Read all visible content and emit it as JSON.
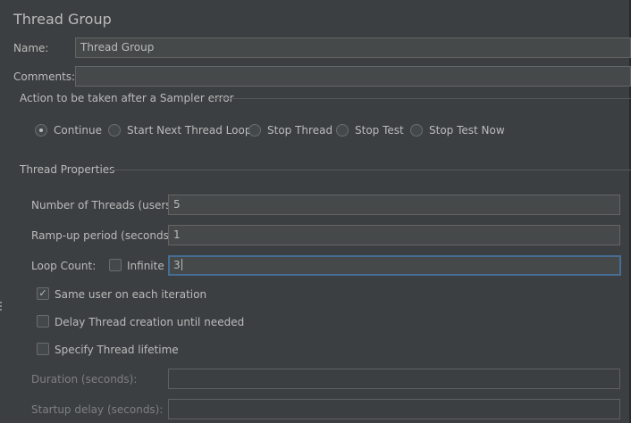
{
  "panel": {
    "title": "Thread Group",
    "name_label": "Name:",
    "name_value": "Thread Group",
    "comments_label": "Comments:",
    "comments_value": ""
  },
  "sampler_error": {
    "section_title": "Action to be taken after a Sampler error",
    "options": [
      {
        "label": "Continue",
        "selected": true
      },
      {
        "label": "Start Next Thread Loop",
        "selected": false
      },
      {
        "label": "Stop Thread",
        "selected": false
      },
      {
        "label": "Stop Test",
        "selected": false
      },
      {
        "label": "Stop Test Now",
        "selected": false
      }
    ]
  },
  "thread_properties": {
    "section_title": "Thread Properties",
    "threads_label": "Number of Threads (users):",
    "threads_value": "5",
    "rampup_label": "Ramp-up period (seconds):",
    "rampup_value": "1",
    "loop_label": "Loop Count:",
    "infinite_label": "Infinite",
    "infinite_checked": false,
    "loop_value": "3",
    "same_user_label": "Same user on each iteration",
    "same_user_checked": true,
    "same_user_check_glyph": "✓",
    "delay_label": "Delay Thread creation until needed",
    "delay_checked": false,
    "lifetime_label": "Specify Thread lifetime",
    "lifetime_checked": false,
    "duration_label": "Duration (seconds):",
    "duration_value": "",
    "startup_delay_label": "Startup delay (seconds):",
    "startup_delay_value": ""
  },
  "colors": {
    "background": "#3c3f41",
    "text": "#bbbbbb",
    "field_bg": "#45494a",
    "focus_border": "#466d94",
    "disabled_text": "#7d7f80"
  }
}
